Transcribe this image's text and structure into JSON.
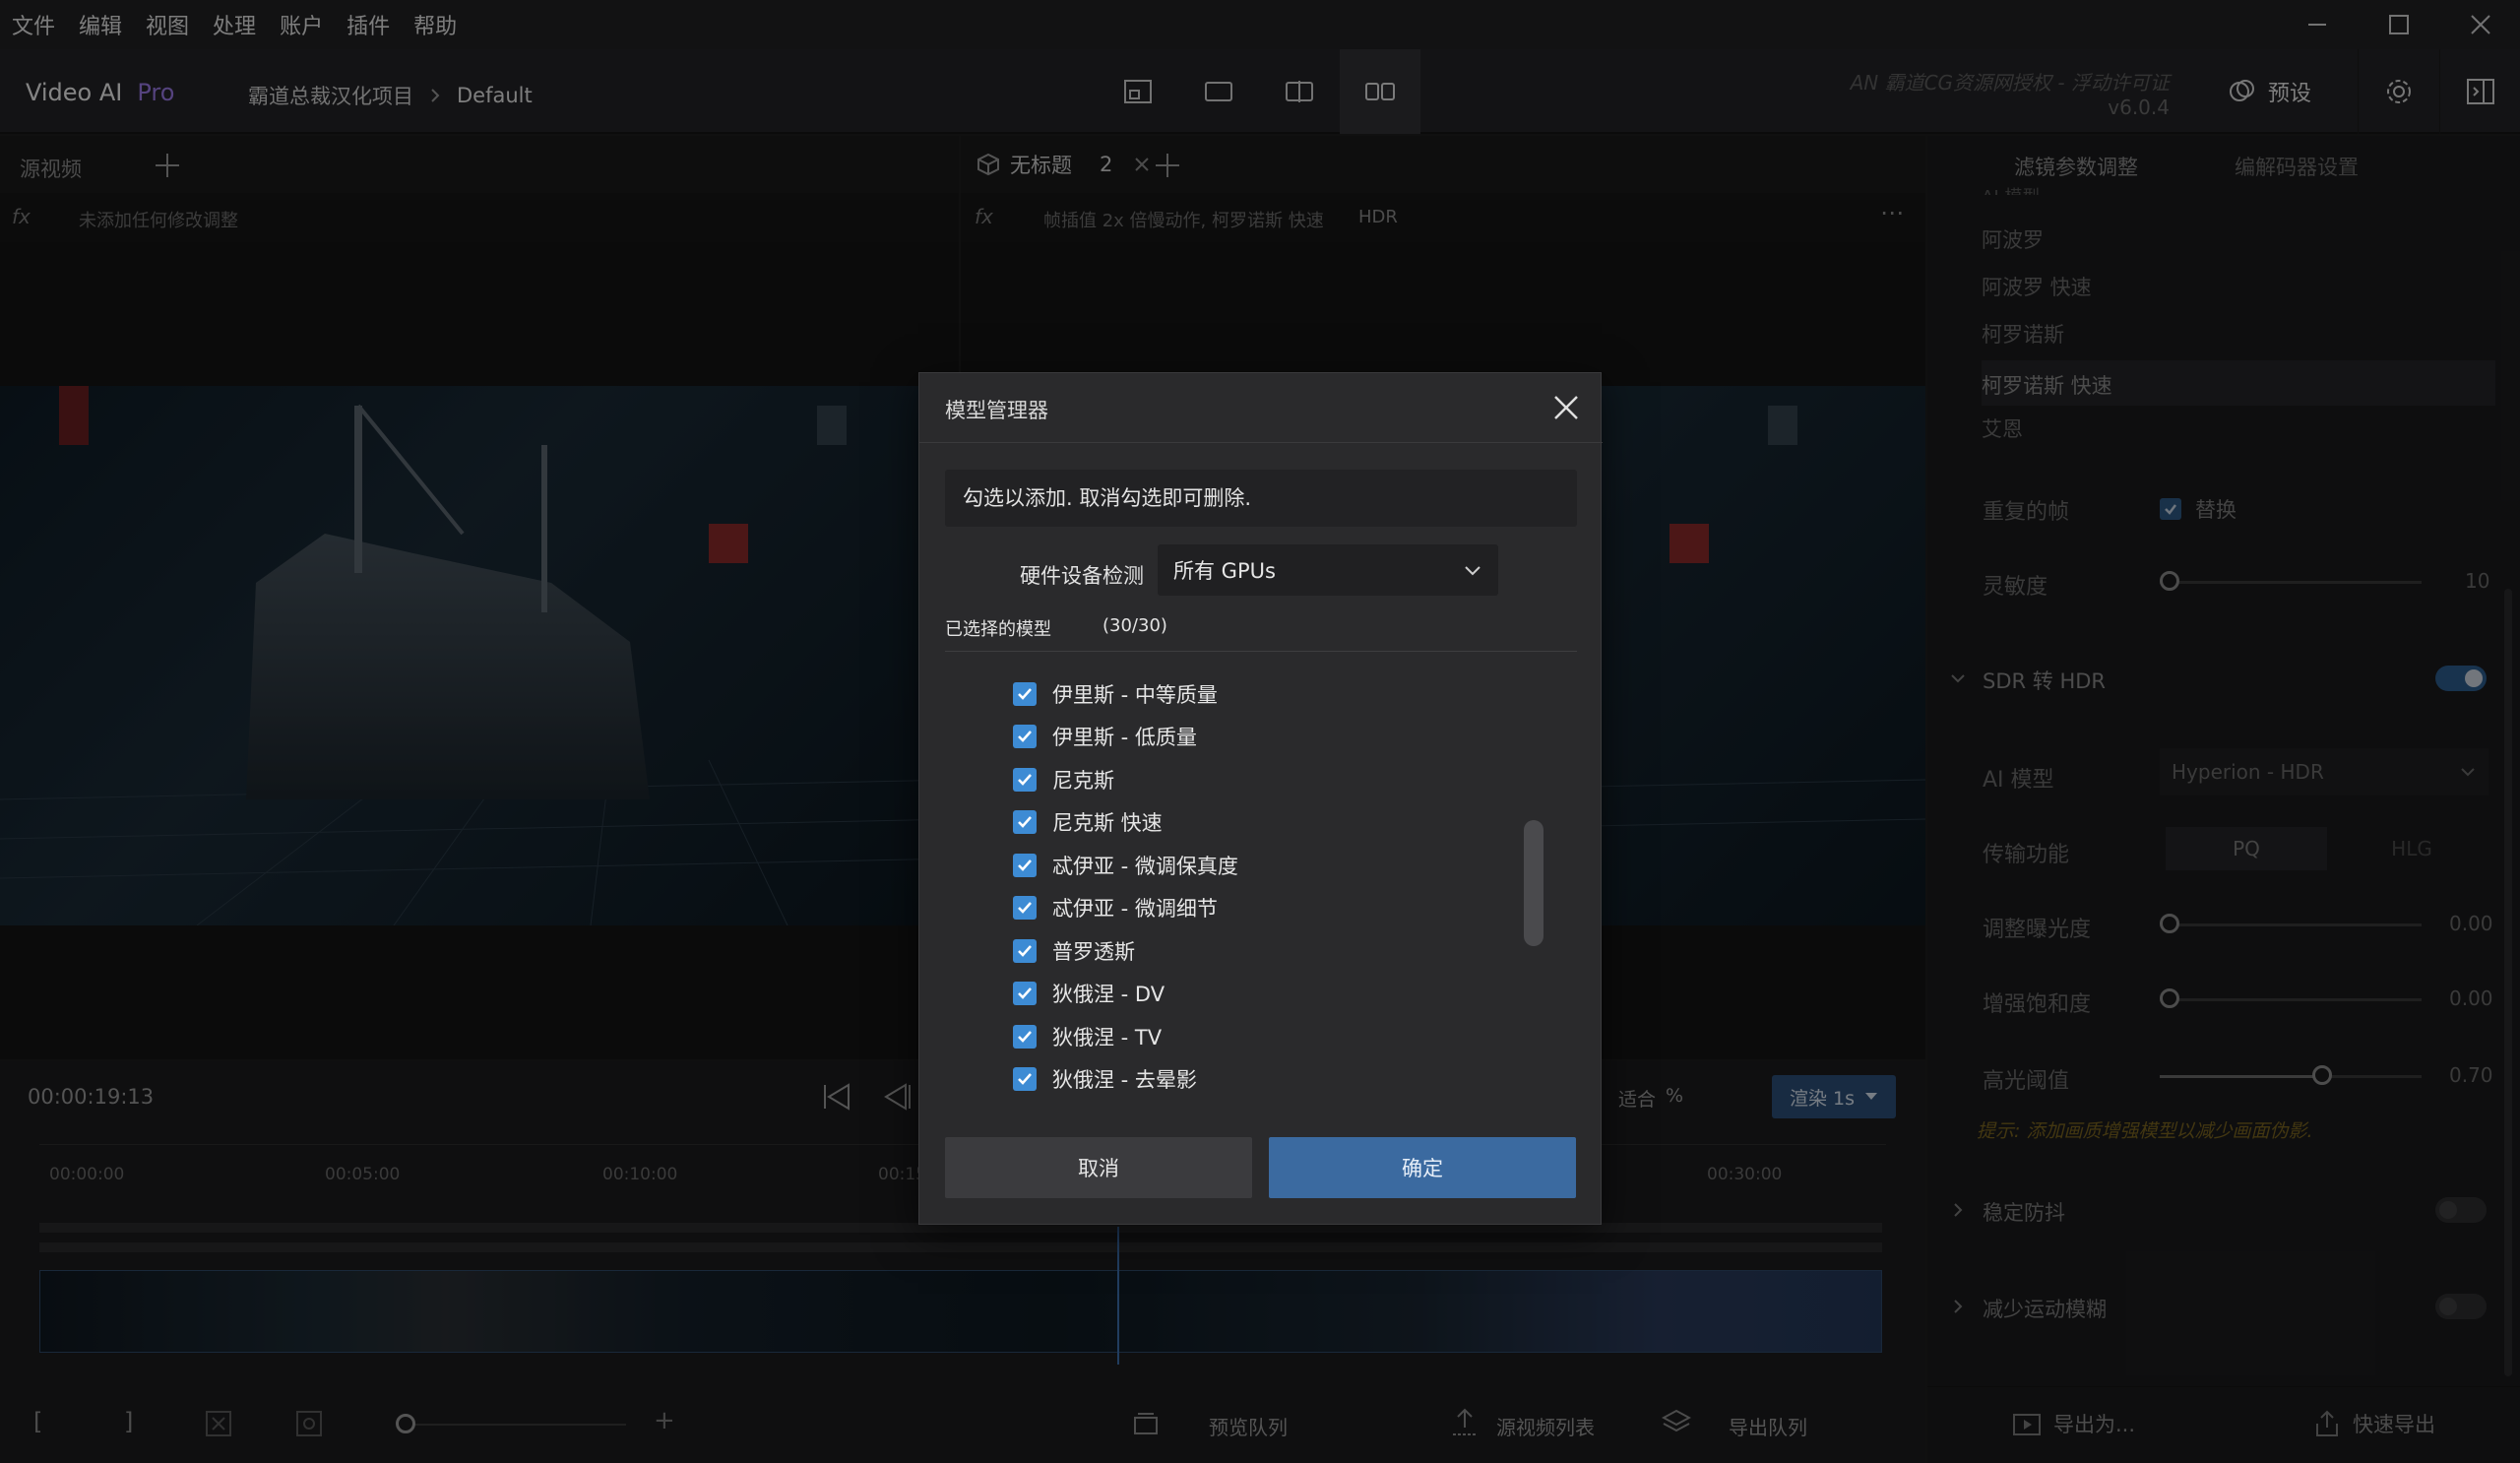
{
  "menu": {
    "items": [
      "文件",
      "编辑",
      "视图",
      "处理",
      "账户",
      "插件",
      "帮助"
    ]
  },
  "toolbar": {
    "app_name": "Video AI",
    "app_edition": "Pro",
    "breadcrumb_project": "霸道总裁汉化项目",
    "breadcrumb_preset": "Default",
    "license_text": "AN 霸道CG资源网授权 - 浮动许可证",
    "version": "v6.0.4",
    "preset_label": "预设"
  },
  "source_pane": {
    "tab_label": "源视频",
    "fx_text": "未添加任何修改调整"
  },
  "output_pane": {
    "tab_label": "无标题",
    "tab_count": "2",
    "fx_text": "帧插值 2x 倍慢动作, 柯罗诺斯 快速",
    "fx_tag": "HDR"
  },
  "timeline": {
    "current_time": "00:00:19:13",
    "zoom_label": "适合",
    "zoom_unit": "%",
    "render_button": "渲染 1s",
    "ticks": [
      "00:00:00",
      "00:05:00",
      "00:10:00",
      "00:15",
      "00:30:00"
    ],
    "footer": {
      "preview_queue": "预览队列",
      "source_list": "源视频列表",
      "export_queue": "导出队列"
    }
  },
  "right_panel": {
    "tabs": [
      "滤镜参数调整",
      "编解码器设置"
    ],
    "model_section_label": "AI 模型",
    "model_list": [
      "阿波罗",
      "阿波罗 快速",
      "柯罗诺斯",
      "柯罗诺斯 快速",
      "艾恩"
    ],
    "selected_model": "柯罗诺斯 快速",
    "duplicate_frames_label": "重复的帧",
    "replace_label": "替换",
    "sensitivity_label": "灵敏度",
    "sensitivity_value": "10",
    "sdr_hdr_label": "SDR 转 HDR",
    "ai_model_label": "AI 模型",
    "ai_model_value": "Hyperion - HDR",
    "transfer_label": "传输功能",
    "transfer_options": [
      "PQ",
      "HLG"
    ],
    "exposure_label": "调整曝光度",
    "exposure_value": "0.00",
    "saturation_label": "增强饱和度",
    "saturation_value": "0.00",
    "highlight_label": "高光阈值",
    "highlight_value": "0.70",
    "highlight_fraction": 0.62,
    "tip": "提示: 添加画质增强模型以减少画面伪影.",
    "stabilize_label": "稳定防抖",
    "motion_blur_label": "减少运动模糊",
    "export_as": "导出为...",
    "quick_export": "快速导出"
  },
  "dialog": {
    "title": "模型管理器",
    "hint": "勾选以添加. 取消勾选即可删除.",
    "hardware_label": "硬件设备检测",
    "hardware_value": "所有 GPUs",
    "selected_label": "已选择的模型",
    "selected_count": "(30/30)",
    "models": [
      "伊里斯 - 中等质量",
      "伊里斯 - 低质量",
      "尼克斯",
      "尼克斯 快速",
      "忒伊亚 - 微调保真度",
      "忒伊亚 - 微调细节",
      "普罗透斯",
      "狄俄涅 - DV",
      "狄俄涅 - TV",
      "狄俄涅 - 去晕影"
    ],
    "cancel": "取消",
    "ok": "确定"
  },
  "colors": {
    "accent_blue": "#3d8bd4",
    "ok_button": "#3b6aa0",
    "pro_purple": "#9b7be8",
    "tip_yellow": "#a8882a"
  }
}
